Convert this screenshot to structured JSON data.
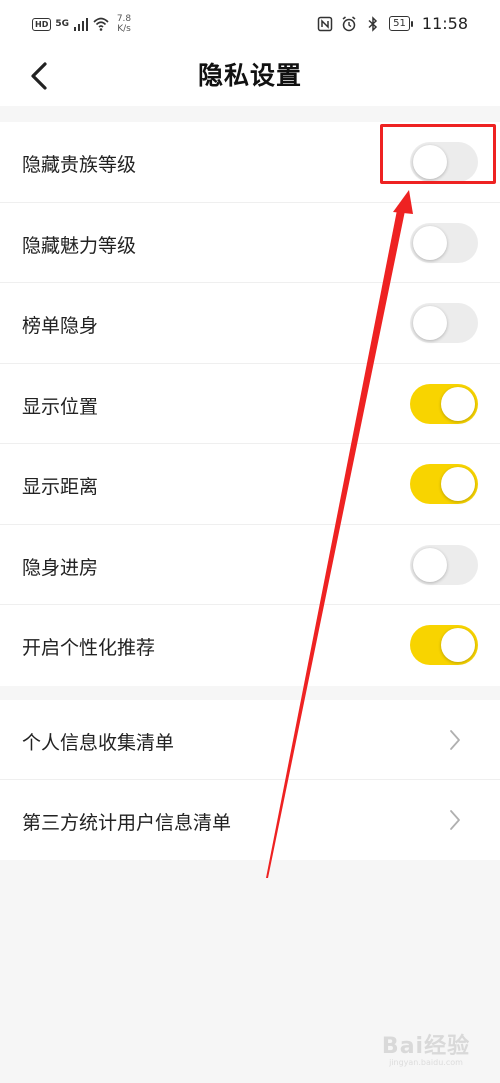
{
  "status_bar": {
    "hd_badge": "HD",
    "network": "5G",
    "speed_value": "7.8",
    "speed_unit": "K/s",
    "battery": "51",
    "time": "11:58",
    "icons": [
      "nfc-icon",
      "alarm-icon",
      "bluetooth-icon",
      "battery-icon",
      "wifi-icon",
      "signal-icon"
    ]
  },
  "header": {
    "title": "隐私设置",
    "back_icon": "chevron-left-icon"
  },
  "settings": [
    {
      "label": "隐藏贵族等级",
      "on": false
    },
    {
      "label": "隐藏魅力等级",
      "on": false
    },
    {
      "label": "榜单隐身",
      "on": false
    },
    {
      "label": "显示位置",
      "on": true
    },
    {
      "label": "显示距离",
      "on": true
    },
    {
      "label": "隐身进房",
      "on": false
    },
    {
      "label": "开启个性化推荐",
      "on": true
    }
  ],
  "links": [
    {
      "label": "个人信息收集清单",
      "icon": "chevron-right-icon"
    },
    {
      "label": "第三方统计用户信息清单",
      "icon": "chevron-right-icon"
    }
  ],
  "colors": {
    "toggle_on": "#f8d400",
    "toggle_off": "#ececec",
    "annotation": "#ee2222",
    "background": "#f6f6f6"
  },
  "watermark": {
    "main": "Bai经验",
    "sub": "jingyan.baidu.com"
  }
}
